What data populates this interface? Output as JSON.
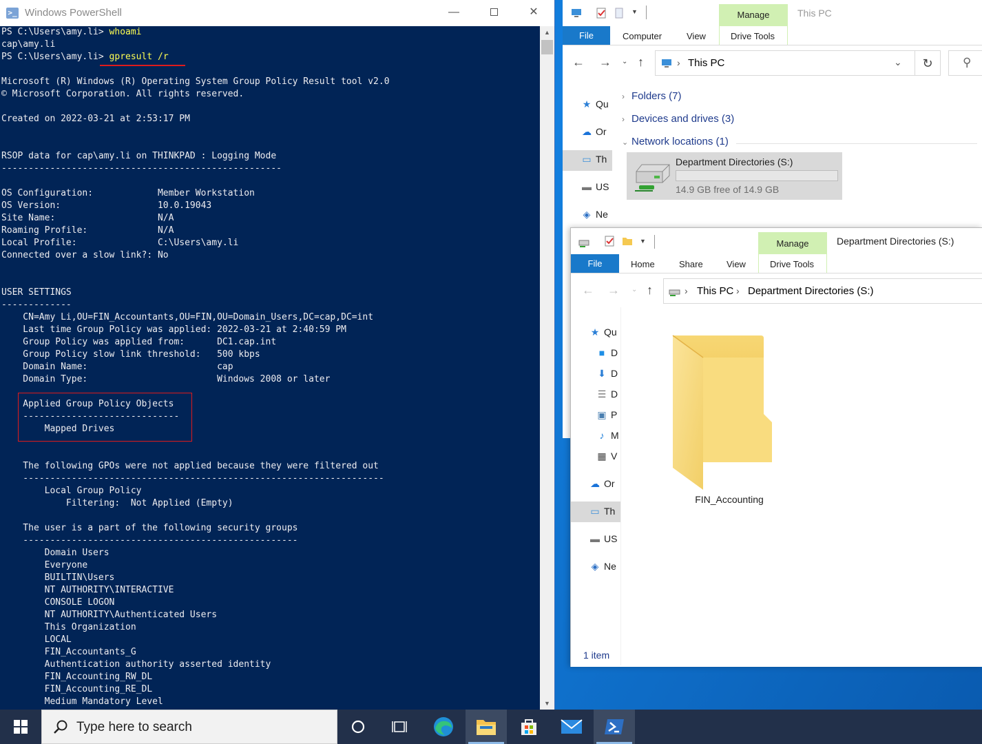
{
  "powershell": {
    "title": "Windows PowerShell",
    "lines": [
      {
        "text": "PS C:\\Users\\amy.li> ",
        "cmd": "whoami"
      },
      {
        "text": "cap\\amy.li"
      },
      {
        "text": "PS C:\\Users\\amy.li> ",
        "cmd": "gpresult /r"
      },
      {
        "text": ""
      },
      {
        "text": "Microsoft (R) Windows (R) Operating System Group Policy Result tool v2.0"
      },
      {
        "text": "© Microsoft Corporation. All rights reserved."
      },
      {
        "text": ""
      },
      {
        "text": "Created on ‎2022‎-‎03-‎21 at 2:53:17 PM"
      },
      {
        "text": ""
      },
      {
        "text": ""
      },
      {
        "text": "RSOP data for cap\\amy.li on THINKPAD : Logging Mode"
      },
      {
        "text": "----------------------------------------------------"
      },
      {
        "text": ""
      },
      {
        "text": "OS Configuration:            Member Workstation"
      },
      {
        "text": "OS Version:                  10.0.19043"
      },
      {
        "text": "Site Name:                   N/A"
      },
      {
        "text": "Roaming Profile:             N/A"
      },
      {
        "text": "Local Profile:               C:\\Users\\amy.li"
      },
      {
        "text": "Connected over a slow link?: No"
      },
      {
        "text": ""
      },
      {
        "text": ""
      },
      {
        "text": "USER SETTINGS"
      },
      {
        "text": "-------------"
      },
      {
        "text": "    CN=Amy Li,OU=FIN_Accountants,OU=FIN,OU=Domain_Users,DC=cap,DC=int"
      },
      {
        "text": "    Last time Group Policy was applied: 2022-03-21 at 2:40:59 PM"
      },
      {
        "text": "    Group Policy was applied from:      DC1.cap.int"
      },
      {
        "text": "    Group Policy slow link threshold:   500 kbps"
      },
      {
        "text": "    Domain Name:                        cap"
      },
      {
        "text": "    Domain Type:                        Windows 2008 or later"
      },
      {
        "text": ""
      },
      {
        "text": "    Applied Group Policy Objects"
      },
      {
        "text": "    -----------------------------"
      },
      {
        "text": "        Mapped Drives"
      },
      {
        "text": ""
      },
      {
        "text": ""
      },
      {
        "text": "    The following GPOs were not applied because they were filtered out"
      },
      {
        "text": "    -------------------------------------------------------------------"
      },
      {
        "text": "        Local Group Policy"
      },
      {
        "text": "            Filtering:  Not Applied (Empty)"
      },
      {
        "text": ""
      },
      {
        "text": "    The user is a part of the following security groups"
      },
      {
        "text": "    ---------------------------------------------------"
      },
      {
        "text": "        Domain Users"
      },
      {
        "text": "        Everyone"
      },
      {
        "text": "        BUILTIN\\Users"
      },
      {
        "text": "        NT AUTHORITY\\INTERACTIVE"
      },
      {
        "text": "        CONSOLE LOGON"
      },
      {
        "text": "        NT AUTHORITY\\Authenticated Users"
      },
      {
        "text": "        This Organization"
      },
      {
        "text": "        LOCAL"
      },
      {
        "text": "        FIN_Accountants_G"
      },
      {
        "text": "        Authentication authority asserted identity"
      },
      {
        "text": "        FIN_Accounting_RW_DL"
      },
      {
        "text": "        FIN_Accounting_RE_DL"
      },
      {
        "text": "        Medium Mandatory Level"
      }
    ]
  },
  "explorer_this_pc": {
    "title": "This PC",
    "tabs": {
      "file": "File",
      "computer": "Computer",
      "view": "View",
      "manage": "Manage",
      "drive_tools": "Drive Tools"
    },
    "address": {
      "crumb": "This PC"
    },
    "sidebar": [
      "Qu",
      "Or",
      "Th",
      "US",
      "Ne"
    ],
    "sections": [
      {
        "label": "Folders (7)",
        "expanded": false
      },
      {
        "label": "Devices and drives (3)",
        "expanded": false
      },
      {
        "label": "Network locations (1)",
        "expanded": true
      }
    ],
    "drive": {
      "name": "Department Directories (S:)",
      "free_text": "14.9 GB free of 14.9 GB",
      "used_fraction": 0.0
    }
  },
  "explorer_drive": {
    "title": "Department Directories (S:)",
    "tabs": {
      "file": "File",
      "home": "Home",
      "share": "Share",
      "view": "View",
      "manage": "Manage",
      "drive_tools": "Drive Tools"
    },
    "address": {
      "crumb1": "This PC",
      "crumb2": "Department Directories (S:)"
    },
    "sidebar": [
      "Qu",
      "D",
      "D",
      "D",
      "P",
      "M",
      "V",
      "Or",
      "Th",
      "US",
      "Ne"
    ],
    "folder": {
      "name": "FIN_Accounting"
    },
    "status": "1 item"
  },
  "taskbar": {
    "search_placeholder": "Type here to search",
    "apps": [
      "cortana-icon",
      "task-view-icon",
      "edge-icon",
      "file-explorer-icon",
      "store-icon",
      "mail-icon",
      "powershell-icon"
    ]
  },
  "colors": {
    "ps_background": "#012456",
    "ps_text": "#eeedf0",
    "ps_command": "#fefd52",
    "annotation_red": "#e01b1b",
    "manage_tab": "#d1f0b3",
    "file_tab": "#1979ca"
  }
}
